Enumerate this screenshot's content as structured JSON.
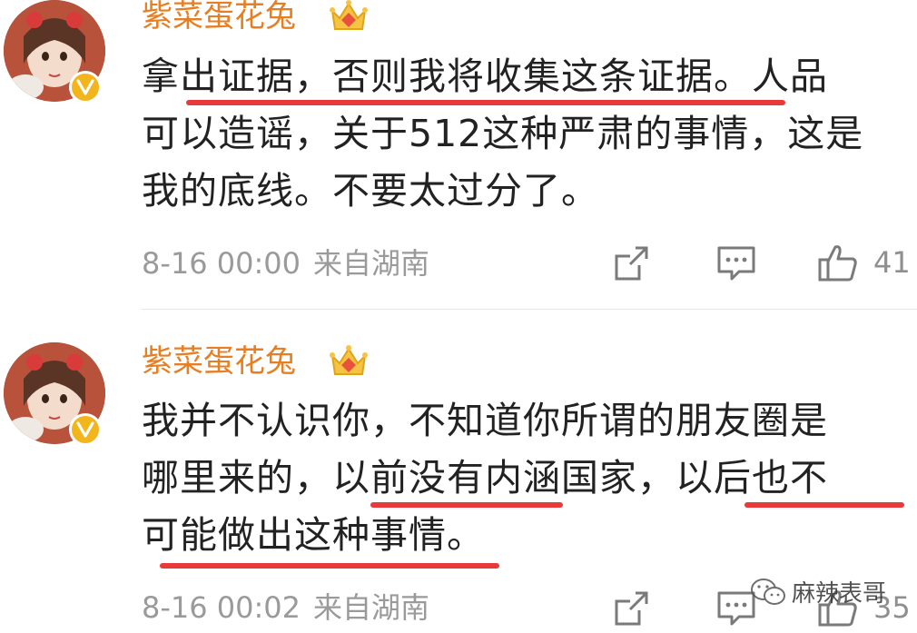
{
  "posts": [
    {
      "username": "紫菜蛋花兔",
      "content": "拿出证据，否则我将收集这条证据。人品可以造谣，关于512这种严肃的事情，这是我的底线。不要太过分了。",
      "content_lines": [
        "拿出证据，否则我将收集这条证据。人品",
        "可以造谣，关于512这种严肃的事情，这是",
        "我的底线。不要太过分了。"
      ],
      "time": "8-16 00:00",
      "source": "来自湖南",
      "likes": "41"
    },
    {
      "username": "紫菜蛋花兔",
      "content": "我并不认识你，不知道你所谓的朋友圈是哪里来的，以前没有内涵国家，以后也不可能做出这种事情。",
      "content_lines": [
        "我并不认识你，不知道你所谓的朋友圈是",
        "哪里来的，以前没有内涵国家，以后也不",
        "可能做出这种事情。"
      ],
      "time": "8-16 00:02",
      "source": "来自湖南",
      "likes": "35"
    }
  ],
  "watermark": "麻辣表哥",
  "icons": {
    "crown": "crown-icon",
    "verify": "verified-v-icon",
    "share": "share-icon",
    "comment": "comment-icon",
    "like": "thumbs-up-icon",
    "watermark": "wechat-logo-icon"
  },
  "colors": {
    "username": "#e77e22",
    "underline": "#e83a3a",
    "meta": "#9a9a9a",
    "badge": "#f2b51c"
  }
}
